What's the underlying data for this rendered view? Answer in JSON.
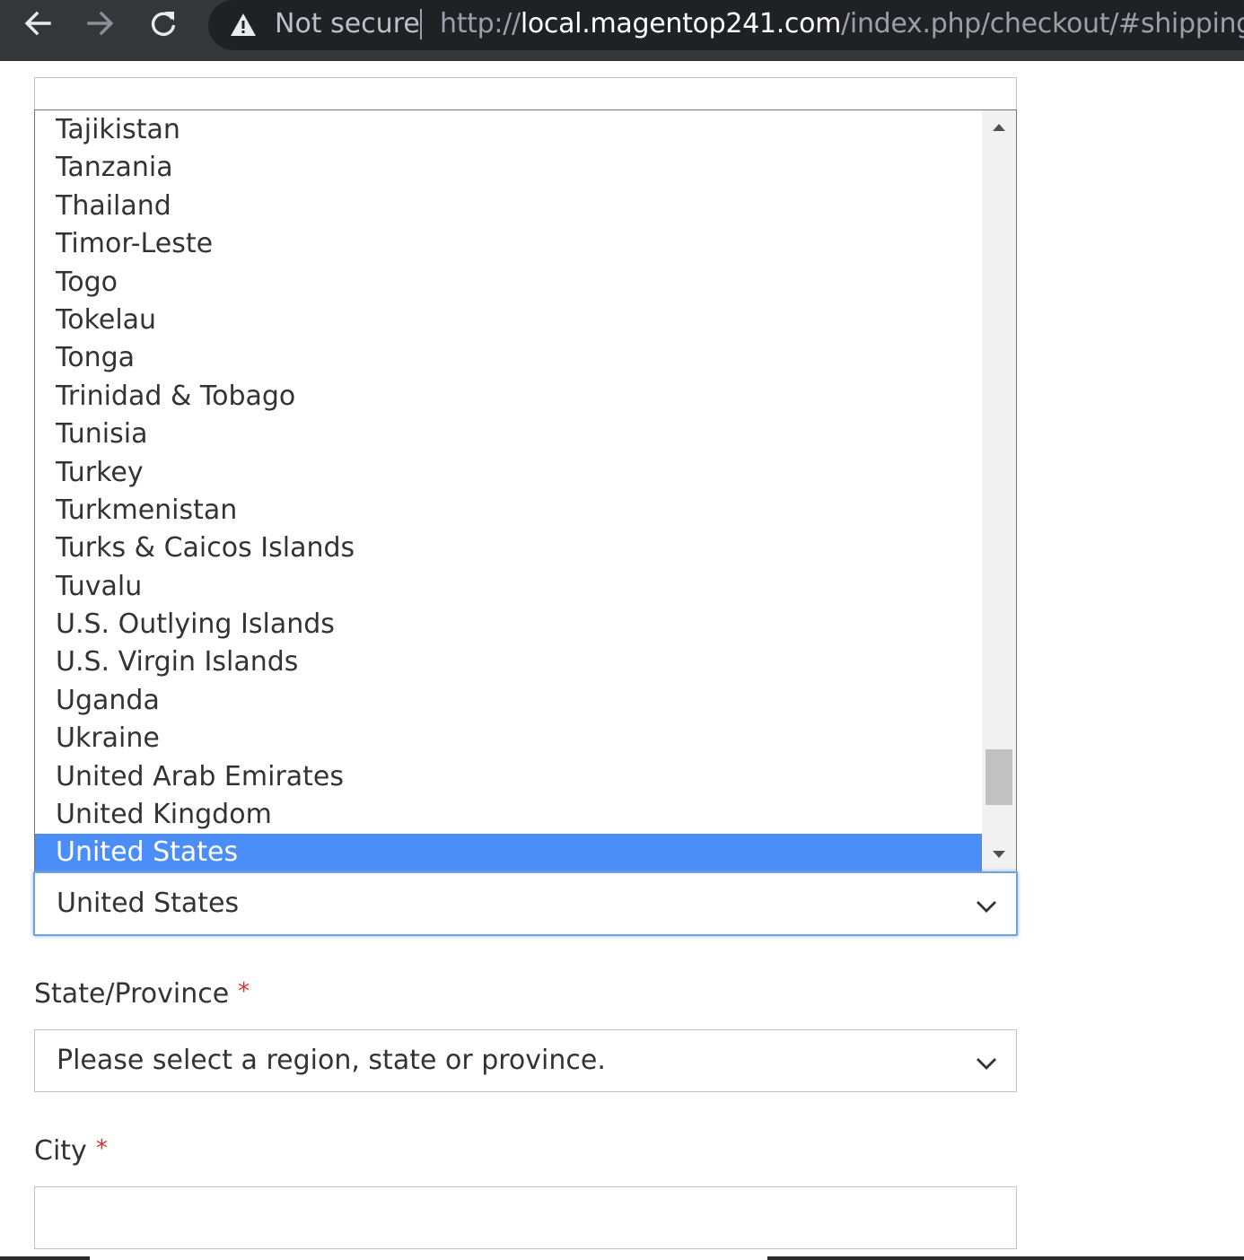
{
  "browser": {
    "security_label": "Not secure",
    "url": {
      "scheme": "http://",
      "host": "local.magentop241.com",
      "path": "/index.php/checkout/#shipping"
    },
    "icons": {
      "back": "arrow-left-icon",
      "forward": "arrow-right-icon",
      "reload": "reload-icon",
      "security": "warning-triangle-icon"
    },
    "colors": {
      "toolbar": "#35363a",
      "omnibox": "#202124"
    }
  },
  "form": {
    "country": {
      "options": [
        "Tajikistan",
        "Tanzania",
        "Thailand",
        "Timor-Leste",
        "Togo",
        "Tokelau",
        "Tonga",
        "Trinidad & Tobago",
        "Tunisia",
        "Turkey",
        "Turkmenistan",
        "Turks & Caicos Islands",
        "Tuvalu",
        "U.S. Outlying Islands",
        "U.S. Virgin Islands",
        "Uganda",
        "Ukraine",
        "United Arab Emirates",
        "United Kingdom",
        "United States"
      ],
      "selected": "United States",
      "highlight_color": "#4c8ef7"
    },
    "state": {
      "label": "State/Province",
      "required_mark": "*",
      "placeholder": "Please select a region, state or province."
    },
    "city": {
      "label": "City",
      "required_mark": "*",
      "value": ""
    },
    "colors": {
      "required": "#e02b27",
      "focus_border": "#6fa3dd"
    }
  }
}
